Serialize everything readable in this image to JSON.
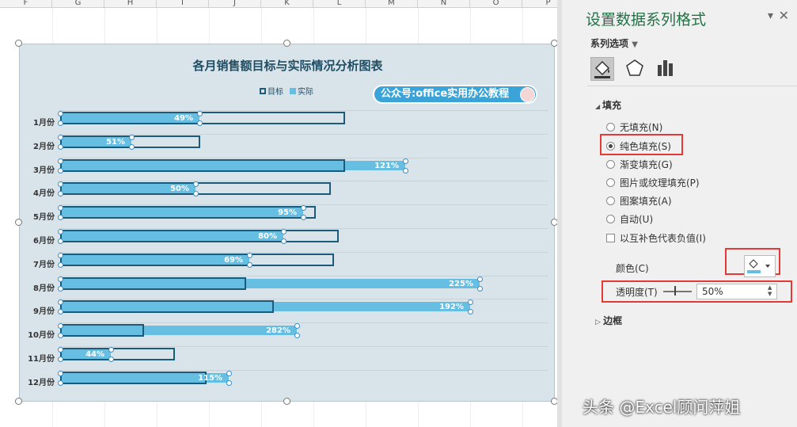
{
  "sheet": {
    "columns": [
      "F",
      "G",
      "H",
      "I",
      "J",
      "K",
      "L",
      "M",
      "N",
      "O",
      "P"
    ]
  },
  "chart": {
    "title": "各月销售额目标与实际情况分析图表",
    "legend": [
      {
        "label": "目标",
        "color": "#1b5a78",
        "style": "outline"
      },
      {
        "label": "实际",
        "color": "#66bfe3",
        "style": "fill"
      }
    ],
    "watermark": "公众号:office实用办公教程",
    "chart_data": {
      "type": "bar",
      "orientation": "horizontal",
      "categories": [
        "1月份",
        "2月份",
        "3月份",
        "4月份",
        "5月份",
        "6月份",
        "7月份",
        "8月份",
        "9月份",
        "10月份",
        "11月份",
        "12月份"
      ],
      "series": [
        {
          "name": "目标",
          "values": [
            360,
            177,
            360,
            342,
            323,
            352,
            346,
            235,
            270,
            106,
            145,
            185
          ]
        },
        {
          "name": "实际",
          "values": [
            176,
            90,
            436,
            171,
            307,
            282,
            239,
            530,
            518,
            299,
            64,
            213
          ]
        }
      ],
      "data_labels": [
        "49%",
        "51%",
        "121%",
        "50%",
        "95%",
        "80%",
        "69%",
        "225%",
        "192%",
        "282%",
        "44%",
        "115%"
      ],
      "colors": {
        "target": "#1b5a78",
        "actual": "#66bfe3"
      },
      "grid": true,
      "legend_position": "top-center"
    }
  },
  "panel": {
    "title": "设置数据系列格式",
    "series_options": "系列选项",
    "fill_section": "填充",
    "fill_options": [
      {
        "label": "无填充(N)",
        "selected": false
      },
      {
        "label": "纯色填充(S)",
        "selected": true
      },
      {
        "label": "渐变填充(G)",
        "selected": false
      },
      {
        "label": "图片或纹理填充(P)",
        "selected": false
      },
      {
        "label": "图案填充(A)",
        "selected": false
      },
      {
        "label": "自动(U)",
        "selected": false
      }
    ],
    "invert_label": "以互补色代表负值(I)",
    "color_label": "颜色(C)",
    "transparency_label": "透明度(T)",
    "transparency_value": "50%",
    "border_section": "边框",
    "accent_color": "#217346"
  },
  "footer_credit": "头条 @Excel顾问萍姐"
}
